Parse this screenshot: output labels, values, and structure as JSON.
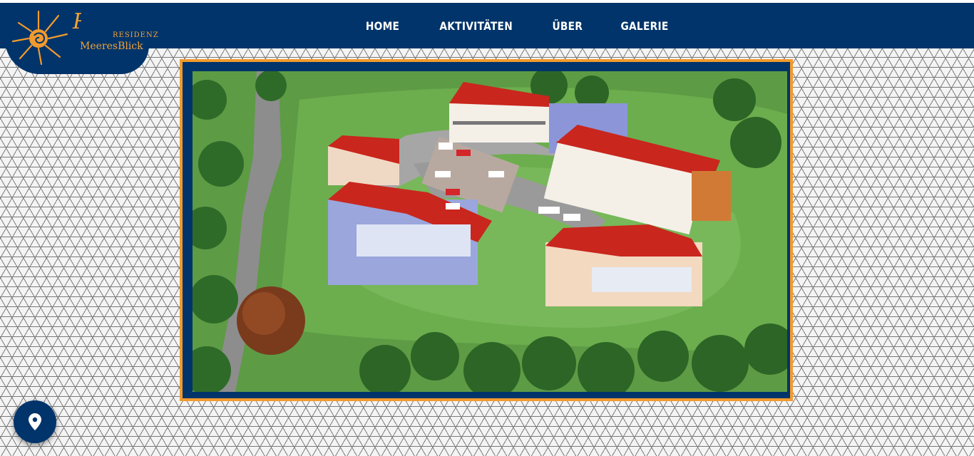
{
  "brand": {
    "monogram": "RM",
    "residenz": "RESIDENZ",
    "name": "MeeresBlick"
  },
  "nav": {
    "items": [
      {
        "label": "HOME"
      },
      {
        "label": "AKTIVITÄTEN"
      },
      {
        "label": "ÜBER"
      },
      {
        "label": "GALERIE"
      }
    ]
  },
  "hero": {
    "image": "aerial-rendering-of-residential-complex"
  },
  "floating": {
    "icon": "map-pin-icon"
  },
  "colors": {
    "navy": "#00346a",
    "orange": "#f39a2e",
    "white": "#ffffff"
  }
}
